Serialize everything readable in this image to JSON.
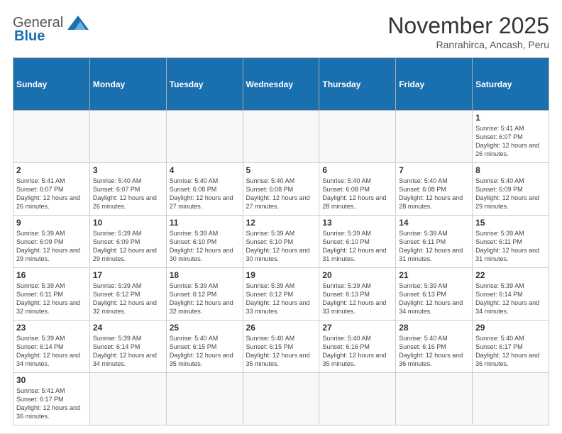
{
  "header": {
    "logo_general": "General",
    "logo_blue": "Blue",
    "month_title": "November 2025",
    "location": "Ranrahirca, Ancash, Peru"
  },
  "weekdays": [
    "Sunday",
    "Monday",
    "Tuesday",
    "Wednesday",
    "Thursday",
    "Friday",
    "Saturday"
  ],
  "weeks": [
    [
      {
        "day": "",
        "info": ""
      },
      {
        "day": "",
        "info": ""
      },
      {
        "day": "",
        "info": ""
      },
      {
        "day": "",
        "info": ""
      },
      {
        "day": "",
        "info": ""
      },
      {
        "day": "",
        "info": ""
      },
      {
        "day": "1",
        "info": "Sunrise: 5:41 AM\nSunset: 6:07 PM\nDaylight: 12 hours\nand 26 minutes."
      }
    ],
    [
      {
        "day": "2",
        "info": "Sunrise: 5:41 AM\nSunset: 6:07 PM\nDaylight: 12 hours\nand 26 minutes."
      },
      {
        "day": "3",
        "info": "Sunrise: 5:40 AM\nSunset: 6:07 PM\nDaylight: 12 hours\nand 26 minutes."
      },
      {
        "day": "4",
        "info": "Sunrise: 5:40 AM\nSunset: 6:08 PM\nDaylight: 12 hours\nand 27 minutes."
      },
      {
        "day": "5",
        "info": "Sunrise: 5:40 AM\nSunset: 6:08 PM\nDaylight: 12 hours\nand 27 minutes."
      },
      {
        "day": "6",
        "info": "Sunrise: 5:40 AM\nSunset: 6:08 PM\nDaylight: 12 hours\nand 28 minutes."
      },
      {
        "day": "7",
        "info": "Sunrise: 5:40 AM\nSunset: 6:08 PM\nDaylight: 12 hours\nand 28 minutes."
      },
      {
        "day": "8",
        "info": "Sunrise: 5:40 AM\nSunset: 6:09 PM\nDaylight: 12 hours\nand 29 minutes."
      }
    ],
    [
      {
        "day": "9",
        "info": "Sunrise: 5:39 AM\nSunset: 6:09 PM\nDaylight: 12 hours\nand 29 minutes."
      },
      {
        "day": "10",
        "info": "Sunrise: 5:39 AM\nSunset: 6:09 PM\nDaylight: 12 hours\nand 29 minutes."
      },
      {
        "day": "11",
        "info": "Sunrise: 5:39 AM\nSunset: 6:10 PM\nDaylight: 12 hours\nand 30 minutes."
      },
      {
        "day": "12",
        "info": "Sunrise: 5:39 AM\nSunset: 6:10 PM\nDaylight: 12 hours\nand 30 minutes."
      },
      {
        "day": "13",
        "info": "Sunrise: 5:39 AM\nSunset: 6:10 PM\nDaylight: 12 hours\nand 31 minutes."
      },
      {
        "day": "14",
        "info": "Sunrise: 5:39 AM\nSunset: 6:11 PM\nDaylight: 12 hours\nand 31 minutes."
      },
      {
        "day": "15",
        "info": "Sunrise: 5:39 AM\nSunset: 6:11 PM\nDaylight: 12 hours\nand 31 minutes."
      }
    ],
    [
      {
        "day": "16",
        "info": "Sunrise: 5:39 AM\nSunset: 6:11 PM\nDaylight: 12 hours\nand 32 minutes."
      },
      {
        "day": "17",
        "info": "Sunrise: 5:39 AM\nSunset: 6:12 PM\nDaylight: 12 hours\nand 32 minutes."
      },
      {
        "day": "18",
        "info": "Sunrise: 5:39 AM\nSunset: 6:12 PM\nDaylight: 12 hours\nand 32 minutes."
      },
      {
        "day": "19",
        "info": "Sunrise: 5:39 AM\nSunset: 6:12 PM\nDaylight: 12 hours\nand 33 minutes."
      },
      {
        "day": "20",
        "info": "Sunrise: 5:39 AM\nSunset: 6:13 PM\nDaylight: 12 hours\nand 33 minutes."
      },
      {
        "day": "21",
        "info": "Sunrise: 5:39 AM\nSunset: 6:13 PM\nDaylight: 12 hours\nand 34 minutes."
      },
      {
        "day": "22",
        "info": "Sunrise: 5:39 AM\nSunset: 6:14 PM\nDaylight: 12 hours\nand 34 minutes."
      }
    ],
    [
      {
        "day": "23",
        "info": "Sunrise: 5:39 AM\nSunset: 6:14 PM\nDaylight: 12 hours\nand 34 minutes."
      },
      {
        "day": "24",
        "info": "Sunrise: 5:39 AM\nSunset: 6:14 PM\nDaylight: 12 hours\nand 34 minutes."
      },
      {
        "day": "25",
        "info": "Sunrise: 5:40 AM\nSunset: 6:15 PM\nDaylight: 12 hours\nand 35 minutes."
      },
      {
        "day": "26",
        "info": "Sunrise: 5:40 AM\nSunset: 6:15 PM\nDaylight: 12 hours\nand 35 minutes."
      },
      {
        "day": "27",
        "info": "Sunrise: 5:40 AM\nSunset: 6:16 PM\nDaylight: 12 hours\nand 35 minutes."
      },
      {
        "day": "28",
        "info": "Sunrise: 5:40 AM\nSunset: 6:16 PM\nDaylight: 12 hours\nand 36 minutes."
      },
      {
        "day": "29",
        "info": "Sunrise: 5:40 AM\nSunset: 6:17 PM\nDaylight: 12 hours\nand 36 minutes."
      }
    ],
    [
      {
        "day": "30",
        "info": "Sunrise: 5:41 AM\nSunset: 6:17 PM\nDaylight: 12 hours\nand 36 minutes."
      },
      {
        "day": "",
        "info": ""
      },
      {
        "day": "",
        "info": ""
      },
      {
        "day": "",
        "info": ""
      },
      {
        "day": "",
        "info": ""
      },
      {
        "day": "",
        "info": ""
      },
      {
        "day": "",
        "info": ""
      }
    ]
  ]
}
